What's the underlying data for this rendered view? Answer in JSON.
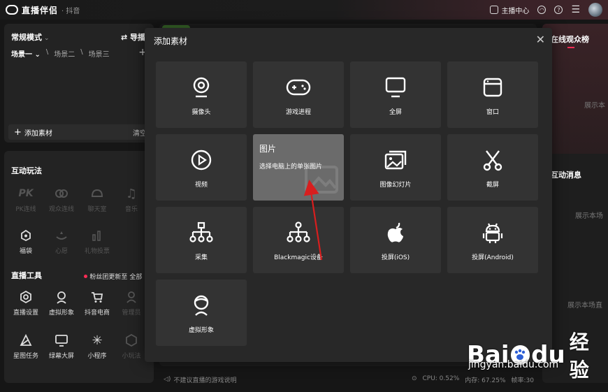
{
  "app": {
    "title": "直播伴侣",
    "subtitle": "· 抖音"
  },
  "titlebar": {
    "anchor_center": "主播中心"
  },
  "left_top": {
    "mode": "常规模式",
    "guide": "导播",
    "scenes": [
      "场景一",
      "场景二",
      "场景三"
    ],
    "add_source": "添加素材",
    "clear": "清空"
  },
  "interactive": {
    "title": "互动玩法",
    "items": [
      {
        "label": "PK连线",
        "icon": "pk-icon",
        "enabled": false
      },
      {
        "label": "观众连线",
        "icon": "link-icon",
        "enabled": false
      },
      {
        "label": "聊天室",
        "icon": "chatroom-icon",
        "enabled": false
      },
      {
        "label": "音乐",
        "icon": "music-icon",
        "enabled": false
      },
      {
        "label": "福袋",
        "icon": "lucky-bag-icon",
        "enabled": true
      },
      {
        "label": "心愿",
        "icon": "wish-icon",
        "enabled": false
      },
      {
        "label": "礼物投票",
        "icon": "vote-icon",
        "enabled": false
      }
    ]
  },
  "live_tools": {
    "title": "直播工具",
    "fans_notice": "粉丝团更新至",
    "all": "全部",
    "items": [
      {
        "label": "直播设置",
        "icon": "settings-icon",
        "enabled": true
      },
      {
        "label": "虚拟形象",
        "icon": "avatar-icon",
        "enabled": true
      },
      {
        "label": "抖音电商",
        "icon": "cart-icon",
        "enabled": true
      },
      {
        "label": "管理员",
        "icon": "admin-icon",
        "enabled": false
      },
      {
        "label": "星图任务",
        "icon": "star-task-icon",
        "enabled": true
      },
      {
        "label": "绿幕大屏",
        "icon": "green-screen-icon",
        "enabled": true
      },
      {
        "label": "小程序",
        "icon": "mini-program-icon",
        "enabled": true
      },
      {
        "label": "小玩法",
        "icon": "mini-game-icon",
        "enabled": false
      }
    ]
  },
  "right_panel": {
    "viewers_title": "在线观众榜",
    "viewers_empty": "展示本",
    "messages_title": "互动消息",
    "messages_empty1": "展示本场",
    "messages_empty2": "展示本场直"
  },
  "status": {
    "hint": "不建议直播的游戏说明",
    "cpu": "CPU: 0.52%",
    "memory": "内存: 67.25%",
    "fps": "帧率:30"
  },
  "dialog": {
    "title": "添加素材",
    "tiles": [
      {
        "label": "摄像头",
        "icon": "camera-icon"
      },
      {
        "label": "游戏进程",
        "icon": "gamepad-icon"
      },
      {
        "label": "全屏",
        "icon": "monitor-icon"
      },
      {
        "label": "窗口",
        "icon": "window-icon"
      },
      {
        "label": "视频",
        "icon": "play-icon"
      },
      {
        "label": "图片",
        "icon": "image-icon",
        "hover_desc": "选择电脑上的单张图片"
      },
      {
        "label": "图像幻灯片",
        "icon": "slideshow-icon"
      },
      {
        "label": "截屏",
        "icon": "scissors-icon"
      },
      {
        "label": "采集",
        "icon": "capture-icon"
      },
      {
        "label": "Blackmagic设备",
        "icon": "blackmagic-icon"
      },
      {
        "label": "投屏(iOS)",
        "icon": "apple-icon"
      },
      {
        "label": "投屏(Android)",
        "icon": "android-icon"
      },
      {
        "label": "虚拟形象",
        "icon": "virtual-avatar-icon"
      }
    ]
  },
  "watermark": {
    "brand": "Bai",
    "brand2": "du",
    "product": "经验",
    "url": "jingyan.baidu.com"
  },
  "colors": {
    "accent": "#fe2c55",
    "tile_bg": "#333333",
    "tile_hover": "#6b6b6b",
    "dialog_bg": "#282828"
  }
}
